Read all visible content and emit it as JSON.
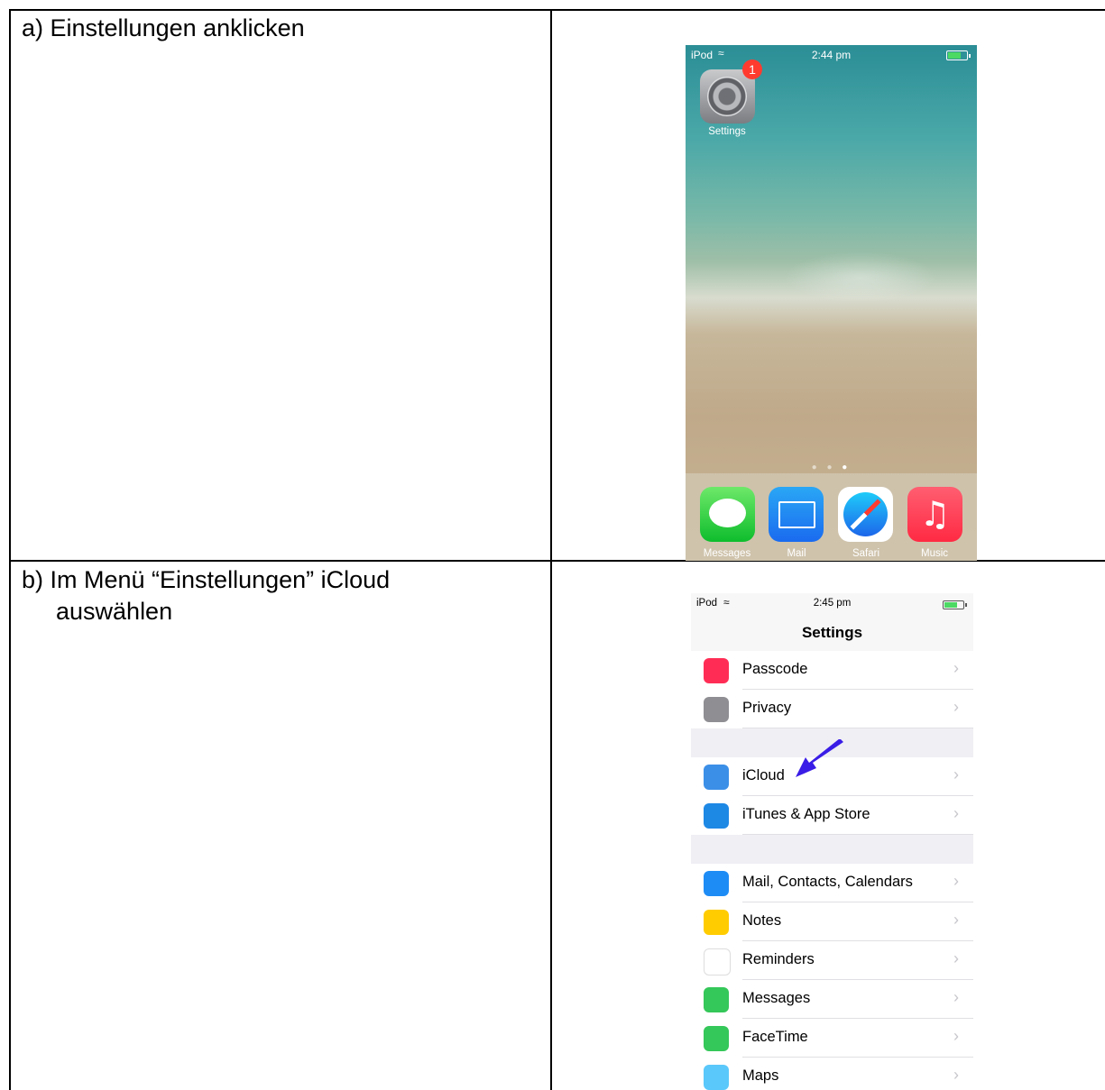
{
  "steps": {
    "a": "a) Einstellungen anklicken",
    "b_line1": "b)  Im Menü “Einstellungen” iCloud",
    "b_line2": "auswählen"
  },
  "home_screen": {
    "status": {
      "carrier": "iPod",
      "time": "2:44 pm"
    },
    "app": {
      "name": "Settings",
      "badge": "1"
    },
    "dock": [
      "Messages",
      "Mail",
      "Safari",
      "Music"
    ]
  },
  "settings_screen": {
    "status": {
      "carrier": "iPod",
      "time": "2:45 pm"
    },
    "title": "Settings",
    "rows": [
      {
        "label": "Passcode",
        "icon": "passcode-icon",
        "color": "#ff2d55"
      },
      {
        "label": "Privacy",
        "icon": "privacy-icon",
        "color": "#8e8e93"
      },
      {
        "label": "iCloud",
        "icon": "icloud-icon",
        "color": "#3b8fe7"
      },
      {
        "label": "iTunes & App Store",
        "icon": "app-store-icon",
        "color": "#1e88e5"
      },
      {
        "label": "Mail, Contacts, Calendars",
        "icon": "mail-icon",
        "color": "#1e8cf5"
      },
      {
        "label": "Notes",
        "icon": "notes-icon",
        "color": "#ffcc00"
      },
      {
        "label": "Reminders",
        "icon": "reminders-icon",
        "color": "#ffffff"
      },
      {
        "label": "Messages",
        "icon": "messages-icon",
        "color": "#34c759"
      },
      {
        "label": "FaceTime",
        "icon": "facetime-icon",
        "color": "#34c759"
      },
      {
        "label": "Maps",
        "icon": "maps-icon",
        "color": "#5ac8fa"
      }
    ],
    "chevron": "›",
    "arrow_color": "#3a1de6"
  }
}
